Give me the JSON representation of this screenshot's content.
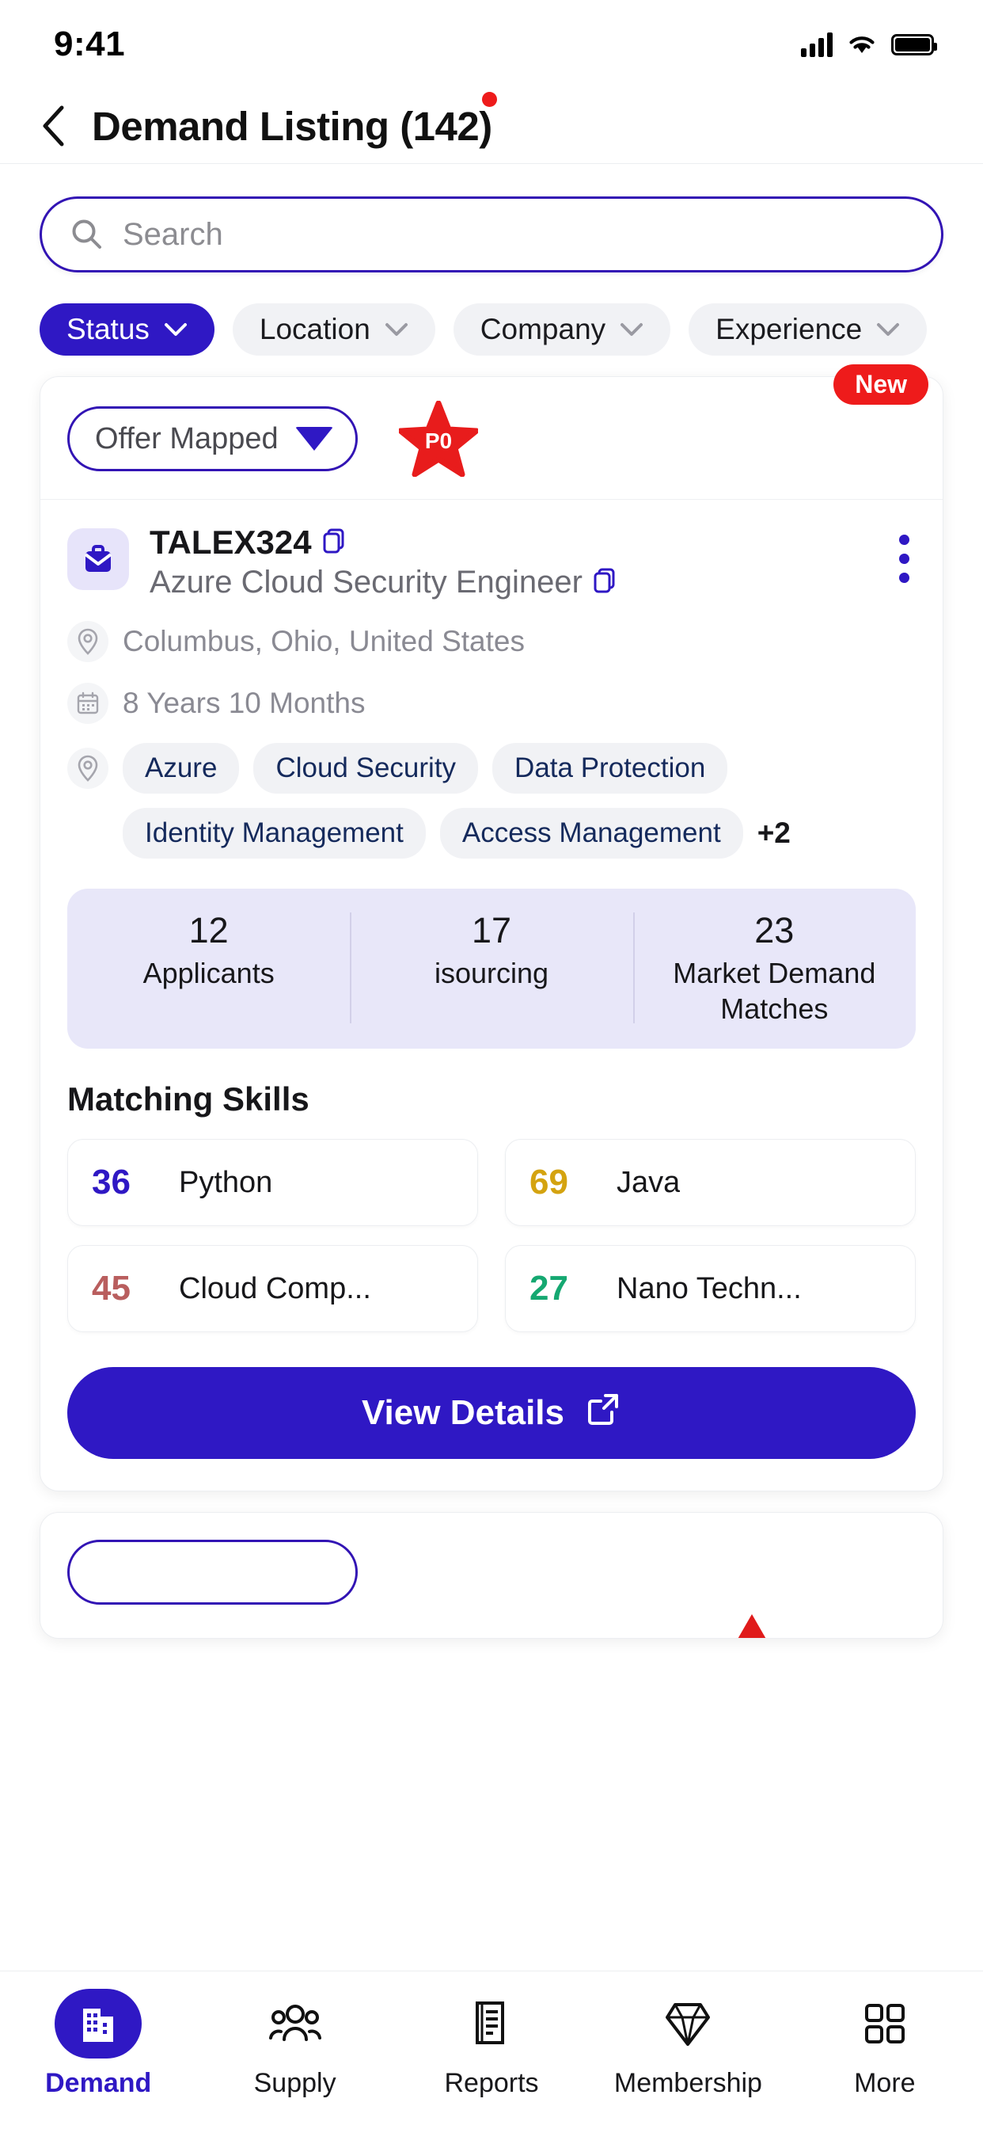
{
  "status_bar": {
    "time": "9:41",
    "signal_icon": "cellular-signal-icon",
    "wifi_icon": "wifi-icon",
    "battery_icon": "battery-icon"
  },
  "header": {
    "back_icon": "back-chevron-icon",
    "title": "Demand Listing (142)",
    "notification_dot": "notification-dot"
  },
  "search": {
    "placeholder": "Search",
    "icon": "search-icon"
  },
  "filters": [
    {
      "label": "Status",
      "active": true
    },
    {
      "label": "Location",
      "active": false
    },
    {
      "label": "Company",
      "active": false
    },
    {
      "label": "Experience",
      "active": false
    }
  ],
  "card": {
    "new_badge": "New",
    "status_value": "Offer Mapped",
    "status_caret_icon": "triangle-down-icon",
    "priority_label": "P0",
    "priority_icon": "star-icon",
    "briefcase_icon": "briefcase-icon",
    "job_id": "TALEX324",
    "job_id_copy_icon": "copy-icon",
    "job_title": "Azure Cloud Security Engineer",
    "job_title_copy_icon": "copy-icon",
    "kebab_icon": "more-vertical-icon",
    "location_icon": "location-pin-icon",
    "location": "Columbus, Ohio, United States",
    "experience_icon": "calendar-icon",
    "experience": "8 Years 10 Months",
    "skills_icon": "location-pin-icon",
    "skill_tags": [
      "Azure",
      "Cloud Security",
      "Data Protection",
      "Identity Management",
      "Access Management"
    ],
    "skill_tags_more": "+2",
    "stats": [
      {
        "value": "12",
        "label": "Applicants"
      },
      {
        "value": "17",
        "label": "isourcing"
      },
      {
        "value": "23",
        "label": "Market Demand Matches"
      }
    ],
    "matching_skills_title": "Matching Skills",
    "matching_skills": [
      {
        "value": "36",
        "name": "Python",
        "color": "#2f18c4"
      },
      {
        "value": "69",
        "name": "Java",
        "color": "#d4a310"
      },
      {
        "value": "45",
        "name": "Cloud Comp...",
        "color": "#b95e5e"
      },
      {
        "value": "27",
        "name": "Nano Techn...",
        "color": "#15a871"
      }
    ],
    "view_details_label": "View Details",
    "view_details_icon": "external-link-icon"
  },
  "card2": {
    "status_value": ""
  },
  "bottom_nav": [
    {
      "label": "Demand",
      "icon": "building-icon",
      "active": true
    },
    {
      "label": "Supply",
      "icon": "people-group-icon",
      "active": false
    },
    {
      "label": "Reports",
      "icon": "document-icon",
      "active": false
    },
    {
      "label": "Membership",
      "icon": "diamond-icon",
      "active": false
    },
    {
      "label": "More",
      "icon": "grid-squares-icon",
      "active": false
    }
  ],
  "colors": {
    "primary": "#2f18c4",
    "accent_red": "#ee1b1b",
    "chip_bg": "#f1f2f5",
    "stats_bg": "#e8e7f9"
  }
}
